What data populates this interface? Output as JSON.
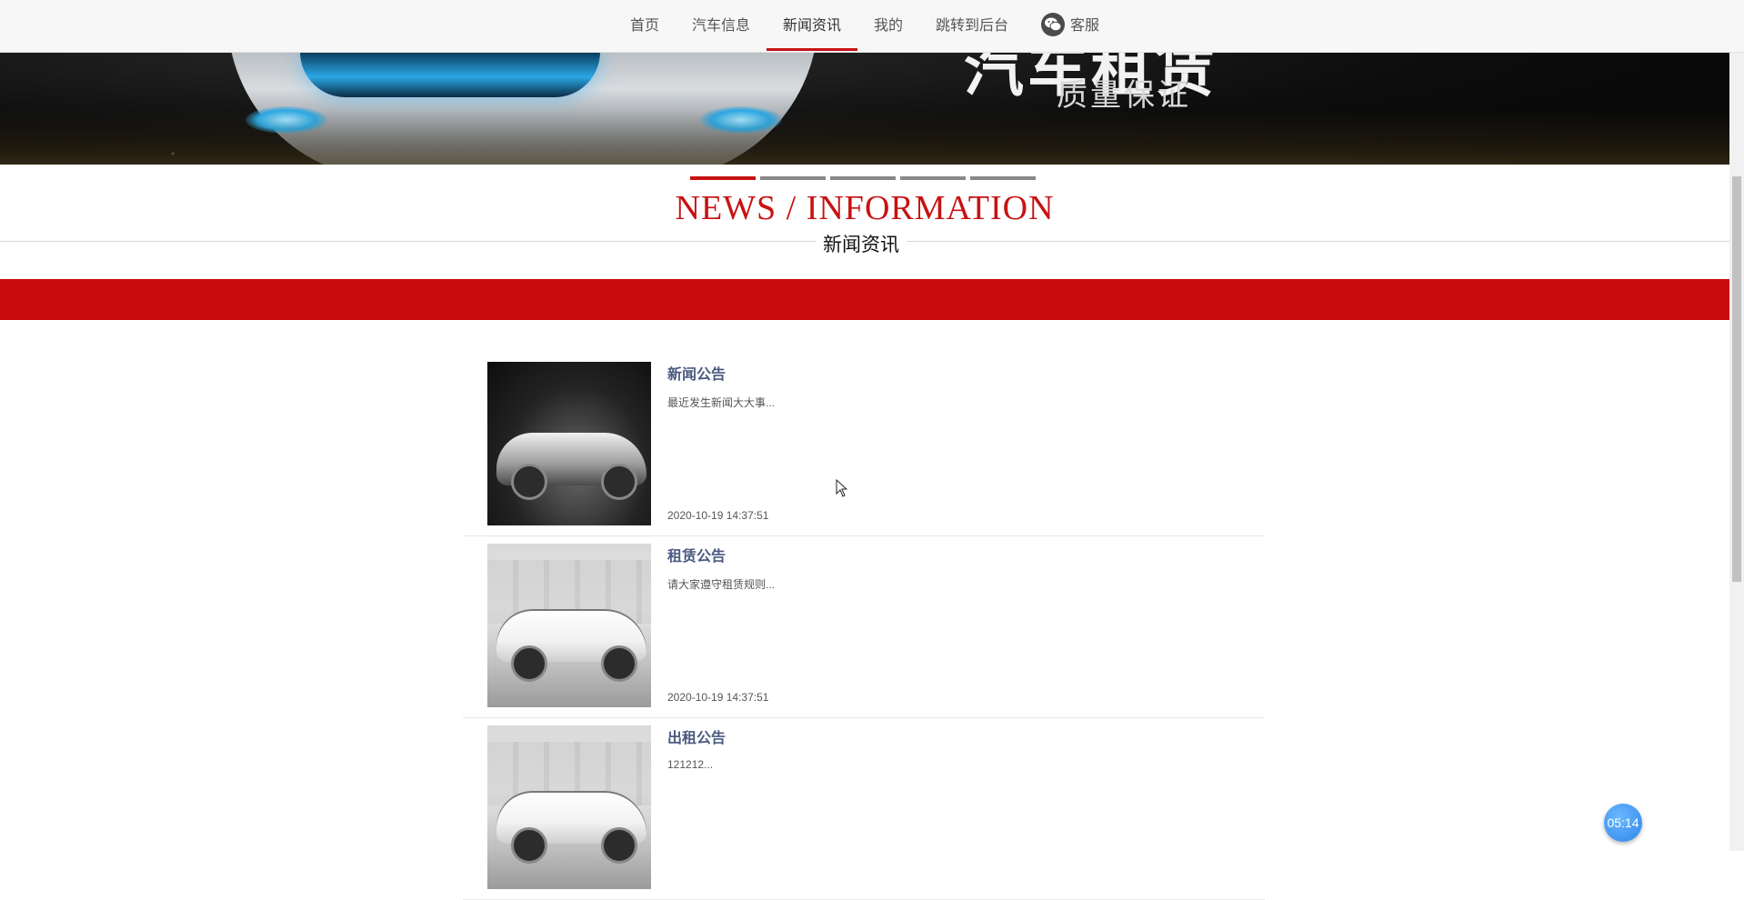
{
  "nav": {
    "items": [
      {
        "label": "首页",
        "active": false
      },
      {
        "label": "汽车信息",
        "active": false
      },
      {
        "label": "新闻资讯",
        "active": true
      },
      {
        "label": "我的",
        "active": false
      },
      {
        "label": "跳转到后台",
        "active": false
      }
    ],
    "service": {
      "label": "客服",
      "icon": "wechat-icon"
    }
  },
  "banner": {
    "headline": "汽车租赁",
    "slogan": "质量保证",
    "indicator_count": 5,
    "active_indicator": 0
  },
  "section": {
    "title_en": "NEWS / INFORMATION",
    "title_cn": "新闻资讯"
  },
  "news": [
    {
      "title": "新闻公告",
      "excerpt": "最近发生新闻大大事...",
      "time": "2020-10-19 14:37:51"
    },
    {
      "title": "租赁公告",
      "excerpt": "请大家遵守租赁规则...",
      "time": "2020-10-19 14:37:51"
    },
    {
      "title": "出租公告",
      "excerpt": "121212...",
      "time": ""
    }
  ],
  "timer": {
    "label": "05:14"
  },
  "colors": {
    "accent": "#c81212",
    "news_title": "#4a5a80",
    "timer": "#2d86e8"
  }
}
